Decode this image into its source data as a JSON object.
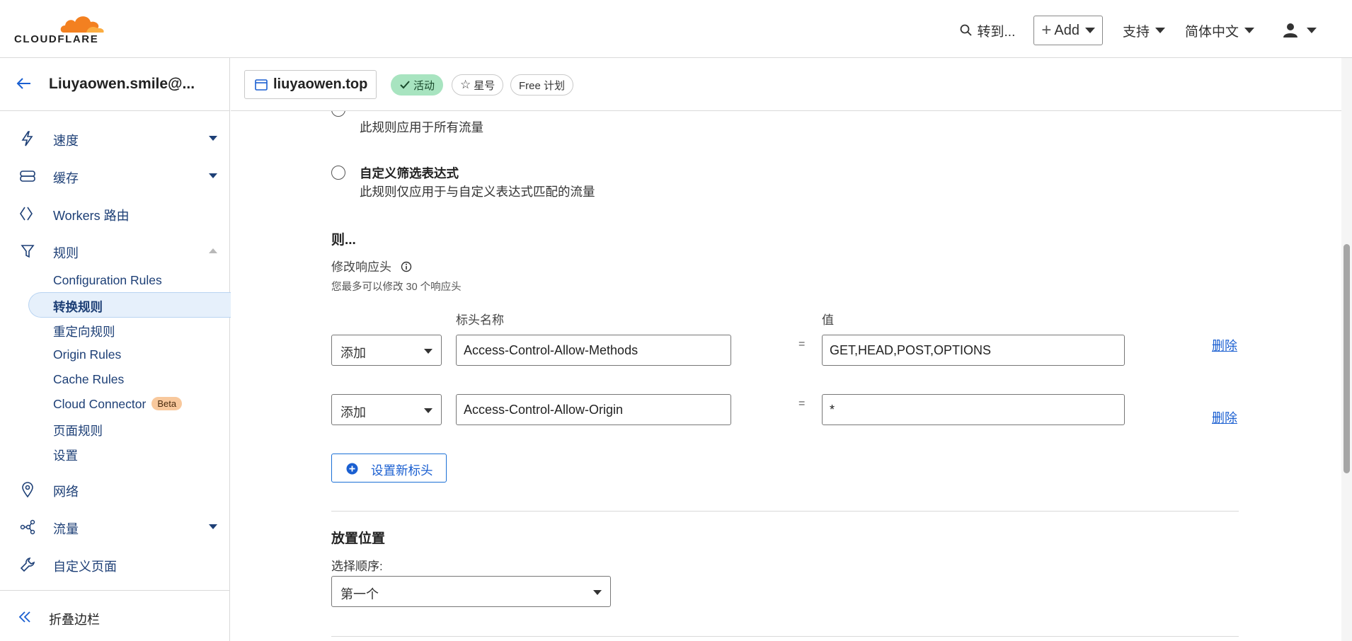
{
  "header": {
    "brand": "CLOUDFLARE",
    "goto_label": "转到...",
    "add_label": "Add",
    "support_label": "支持",
    "language_label": "简体中文"
  },
  "sidebar": {
    "account_name": "Liuyaowen.smile@...",
    "items": [
      {
        "label": "速度"
      },
      {
        "label": "缓存"
      },
      {
        "label": "Workers 路由"
      },
      {
        "label": "规则"
      }
    ],
    "subitems": [
      {
        "label": "Configuration Rules"
      },
      {
        "label": "转换规则"
      },
      {
        "label": "重定向规则"
      },
      {
        "label": "Origin Rules"
      },
      {
        "label": "Cache Rules"
      },
      {
        "label": "Cloud Connector"
      },
      {
        "label": "页面规则"
      },
      {
        "label": "设置"
      }
    ],
    "beta_label": "Beta",
    "items_after": [
      {
        "label": "网络"
      },
      {
        "label": "流量"
      },
      {
        "label": "自定义页面"
      }
    ],
    "collapse_label": "折叠边栏"
  },
  "zone": {
    "domain": "liuyaowen.top",
    "status": "活动",
    "star_label": "星号",
    "plan_label": "Free 计划"
  },
  "main": {
    "option_all_desc": "此规则应用于所有流量",
    "option_custom_title": "自定义筛选表达式",
    "option_custom_desc": "此规则仅应用于与自定义表达式匹配的流量",
    "then_heading": "则...",
    "modify_label": "修改响应头",
    "modify_hint": "您最多可以修改 30 个响应头",
    "col_header_name": "标头名称",
    "col_value": "值",
    "rows": [
      {
        "action": "添加",
        "name": "Access-Control-Allow-Methods",
        "value": "GET,HEAD,POST,OPTIONS",
        "delete": "删除"
      },
      {
        "action": "添加",
        "name": "Access-Control-Allow-Origin",
        "value": "*",
        "delete": "删除"
      }
    ],
    "equals": "=",
    "add_header_label": "设置新标头",
    "placement_heading": "放置位置",
    "order_label": "选择顺序:",
    "order_value": "第一个"
  }
}
